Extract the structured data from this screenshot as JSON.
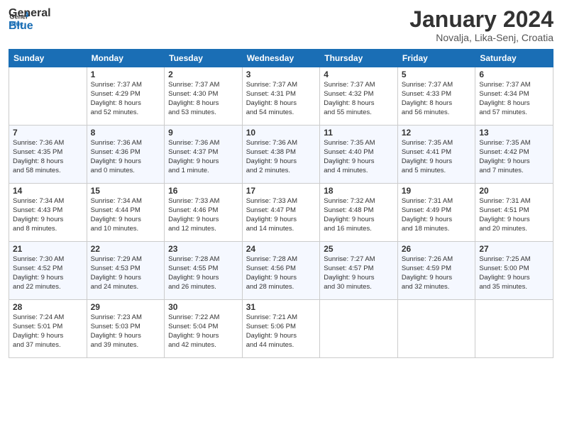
{
  "header": {
    "logo_general": "General",
    "logo_blue": "Blue",
    "month_title": "January 2024",
    "location": "Novalja, Lika-Senj, Croatia"
  },
  "calendar": {
    "days_of_week": [
      "Sunday",
      "Monday",
      "Tuesday",
      "Wednesday",
      "Thursday",
      "Friday",
      "Saturday"
    ],
    "weeks": [
      [
        {
          "day": "",
          "info": ""
        },
        {
          "day": "1",
          "info": "Sunrise: 7:37 AM\nSunset: 4:29 PM\nDaylight: 8 hours\nand 52 minutes."
        },
        {
          "day": "2",
          "info": "Sunrise: 7:37 AM\nSunset: 4:30 PM\nDaylight: 8 hours\nand 53 minutes."
        },
        {
          "day": "3",
          "info": "Sunrise: 7:37 AM\nSunset: 4:31 PM\nDaylight: 8 hours\nand 54 minutes."
        },
        {
          "day": "4",
          "info": "Sunrise: 7:37 AM\nSunset: 4:32 PM\nDaylight: 8 hours\nand 55 minutes."
        },
        {
          "day": "5",
          "info": "Sunrise: 7:37 AM\nSunset: 4:33 PM\nDaylight: 8 hours\nand 56 minutes."
        },
        {
          "day": "6",
          "info": "Sunrise: 7:37 AM\nSunset: 4:34 PM\nDaylight: 8 hours\nand 57 minutes."
        }
      ],
      [
        {
          "day": "7",
          "info": "Sunrise: 7:36 AM\nSunset: 4:35 PM\nDaylight: 8 hours\nand 58 minutes."
        },
        {
          "day": "8",
          "info": "Sunrise: 7:36 AM\nSunset: 4:36 PM\nDaylight: 9 hours\nand 0 minutes."
        },
        {
          "day": "9",
          "info": "Sunrise: 7:36 AM\nSunset: 4:37 PM\nDaylight: 9 hours\nand 1 minute."
        },
        {
          "day": "10",
          "info": "Sunrise: 7:36 AM\nSunset: 4:38 PM\nDaylight: 9 hours\nand 2 minutes."
        },
        {
          "day": "11",
          "info": "Sunrise: 7:35 AM\nSunset: 4:40 PM\nDaylight: 9 hours\nand 4 minutes."
        },
        {
          "day": "12",
          "info": "Sunrise: 7:35 AM\nSunset: 4:41 PM\nDaylight: 9 hours\nand 5 minutes."
        },
        {
          "day": "13",
          "info": "Sunrise: 7:35 AM\nSunset: 4:42 PM\nDaylight: 9 hours\nand 7 minutes."
        }
      ],
      [
        {
          "day": "14",
          "info": "Sunrise: 7:34 AM\nSunset: 4:43 PM\nDaylight: 9 hours\nand 8 minutes."
        },
        {
          "day": "15",
          "info": "Sunrise: 7:34 AM\nSunset: 4:44 PM\nDaylight: 9 hours\nand 10 minutes."
        },
        {
          "day": "16",
          "info": "Sunrise: 7:33 AM\nSunset: 4:46 PM\nDaylight: 9 hours\nand 12 minutes."
        },
        {
          "day": "17",
          "info": "Sunrise: 7:33 AM\nSunset: 4:47 PM\nDaylight: 9 hours\nand 14 minutes."
        },
        {
          "day": "18",
          "info": "Sunrise: 7:32 AM\nSunset: 4:48 PM\nDaylight: 9 hours\nand 16 minutes."
        },
        {
          "day": "19",
          "info": "Sunrise: 7:31 AM\nSunset: 4:49 PM\nDaylight: 9 hours\nand 18 minutes."
        },
        {
          "day": "20",
          "info": "Sunrise: 7:31 AM\nSunset: 4:51 PM\nDaylight: 9 hours\nand 20 minutes."
        }
      ],
      [
        {
          "day": "21",
          "info": "Sunrise: 7:30 AM\nSunset: 4:52 PM\nDaylight: 9 hours\nand 22 minutes."
        },
        {
          "day": "22",
          "info": "Sunrise: 7:29 AM\nSunset: 4:53 PM\nDaylight: 9 hours\nand 24 minutes."
        },
        {
          "day": "23",
          "info": "Sunrise: 7:28 AM\nSunset: 4:55 PM\nDaylight: 9 hours\nand 26 minutes."
        },
        {
          "day": "24",
          "info": "Sunrise: 7:28 AM\nSunset: 4:56 PM\nDaylight: 9 hours\nand 28 minutes."
        },
        {
          "day": "25",
          "info": "Sunrise: 7:27 AM\nSunset: 4:57 PM\nDaylight: 9 hours\nand 30 minutes."
        },
        {
          "day": "26",
          "info": "Sunrise: 7:26 AM\nSunset: 4:59 PM\nDaylight: 9 hours\nand 32 minutes."
        },
        {
          "day": "27",
          "info": "Sunrise: 7:25 AM\nSunset: 5:00 PM\nDaylight: 9 hours\nand 35 minutes."
        }
      ],
      [
        {
          "day": "28",
          "info": "Sunrise: 7:24 AM\nSunset: 5:01 PM\nDaylight: 9 hours\nand 37 minutes."
        },
        {
          "day": "29",
          "info": "Sunrise: 7:23 AM\nSunset: 5:03 PM\nDaylight: 9 hours\nand 39 minutes."
        },
        {
          "day": "30",
          "info": "Sunrise: 7:22 AM\nSunset: 5:04 PM\nDaylight: 9 hours\nand 42 minutes."
        },
        {
          "day": "31",
          "info": "Sunrise: 7:21 AM\nSunset: 5:06 PM\nDaylight: 9 hours\nand 44 minutes."
        },
        {
          "day": "",
          "info": ""
        },
        {
          "day": "",
          "info": ""
        },
        {
          "day": "",
          "info": ""
        }
      ]
    ]
  }
}
